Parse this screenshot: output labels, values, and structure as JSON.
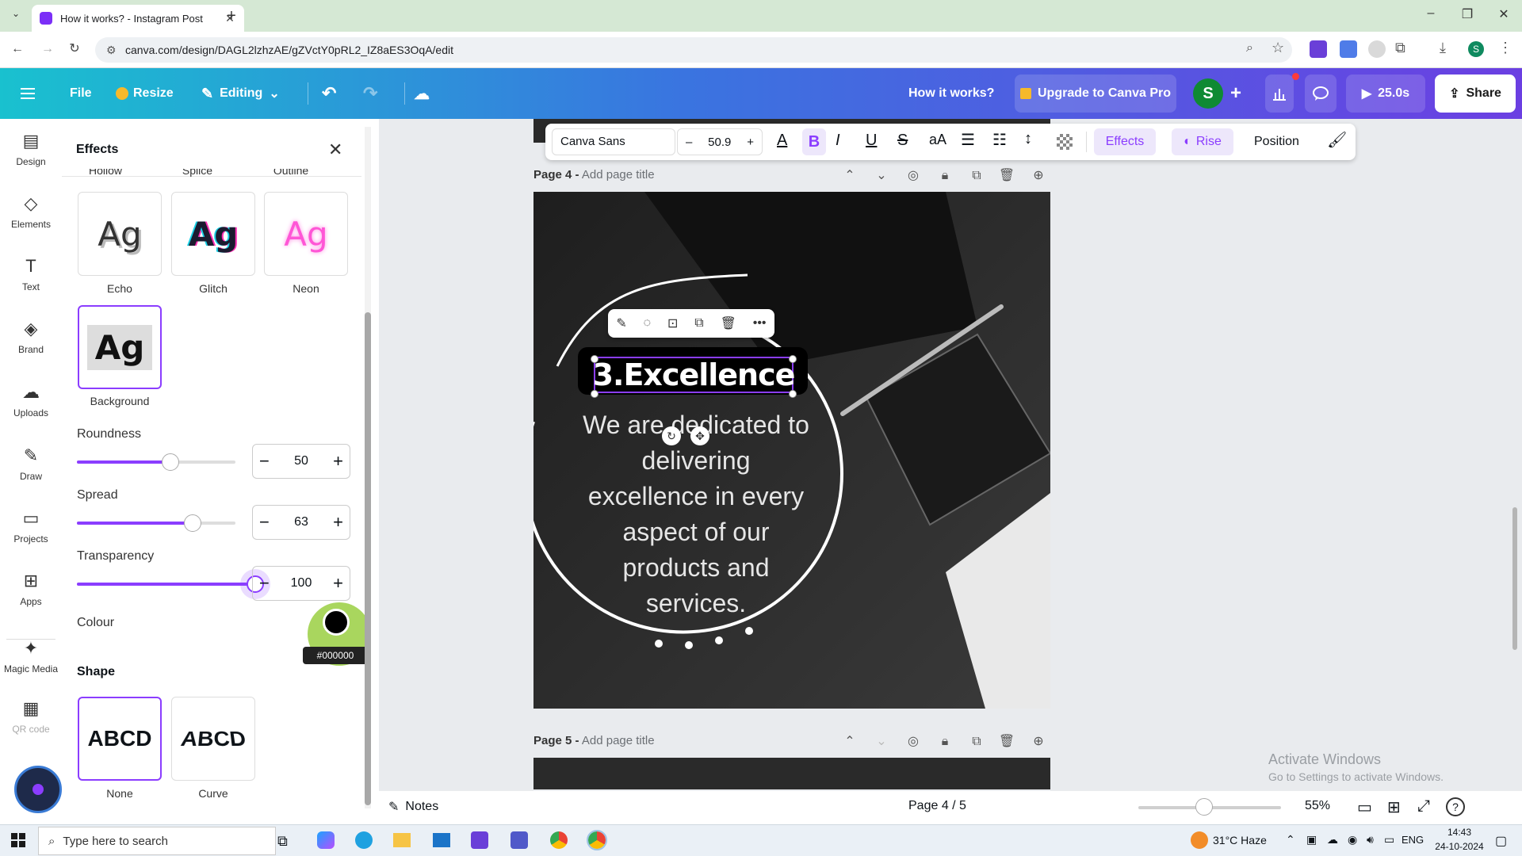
{
  "browser": {
    "tab_title": "How it works? - Instagram Post",
    "new_tab": "+",
    "url": "canva.com/design/DAGL2lzhzAE/gZVctY0pRL2_IZ8aES3OqA/edit",
    "profile_initial": "S"
  },
  "header": {
    "file": "File",
    "resize": "Resize",
    "editing": "Editing",
    "design_title": "How it works?",
    "upgrade": "Upgrade to Canva Pro",
    "avatar_initial": "S",
    "present_time": "25.0s",
    "share": "Share"
  },
  "rail": [
    {
      "label": "Design",
      "icon": "design-icon"
    },
    {
      "label": "Elements",
      "icon": "elements-icon"
    },
    {
      "label": "Text",
      "icon": "text-icon"
    },
    {
      "label": "Brand",
      "icon": "brand-icon"
    },
    {
      "label": "Uploads",
      "icon": "uploads-icon"
    },
    {
      "label": "Draw",
      "icon": "draw-icon"
    },
    {
      "label": "Projects",
      "icon": "projects-icon"
    },
    {
      "label": "Apps",
      "icon": "apps-icon"
    },
    {
      "label": "Magic Media",
      "icon": "magic-media-icon"
    },
    {
      "label": "QR code",
      "icon": "qr-code-icon"
    }
  ],
  "panel": {
    "title": "Effects",
    "cut_labels": [
      "Hollow",
      "Splice",
      "Outline"
    ],
    "effects": [
      {
        "label": "Echo",
        "sample": "Ag"
      },
      {
        "label": "Glitch",
        "sample": "Ag"
      },
      {
        "label": "Neon",
        "sample": "Ag"
      },
      {
        "label": "Background",
        "sample": "Ag"
      }
    ],
    "roundness": {
      "label": "Roundness",
      "value": "50",
      "fraction": 0.5
    },
    "spread": {
      "label": "Spread",
      "value": "63",
      "fraction": 0.63
    },
    "transparency": {
      "label": "Transparency",
      "value": "100",
      "fraction": 1.0
    },
    "colour": {
      "label": "Colour",
      "value": "#000000"
    },
    "shape": {
      "title": "Shape",
      "options": [
        {
          "label": "None",
          "sample": "ABCD"
        },
        {
          "label": "Curve",
          "sample": "ABCD"
        }
      ]
    }
  },
  "toolbar": {
    "font": "Canva Sans",
    "minus": "–",
    "font_size": "50.9",
    "plus": "+",
    "effects": "Effects",
    "animation": "Rise",
    "position": "Position"
  },
  "pages": {
    "page4_label": "Page 4 -",
    "page4_title": "Add page title",
    "page5_label": "Page 5 -",
    "page5_title": "Add page title"
  },
  "design": {
    "heading": "3.Excellence",
    "body_lines": [
      "We are dedicated to",
      "delivering",
      "excellence in every",
      "aspect of our",
      "products and",
      "services."
    ]
  },
  "bottom": {
    "notes": "Notes",
    "page_counter": "Page 4 / 5",
    "zoom": "55%",
    "zoom_fraction": 0.46,
    "watermark_title": "Activate Windows",
    "watermark_sub": "Go to Settings to activate Windows."
  },
  "taskbar": {
    "search_placeholder": "Type here to search",
    "weather": "31°C  Haze",
    "lang": "ENG",
    "time": "14:43",
    "date": "24-10-2024"
  },
  "colors": {
    "accent": "#8b3dff",
    "header_start": "#19c1cf",
    "header_end": "#6b3fe2"
  }
}
